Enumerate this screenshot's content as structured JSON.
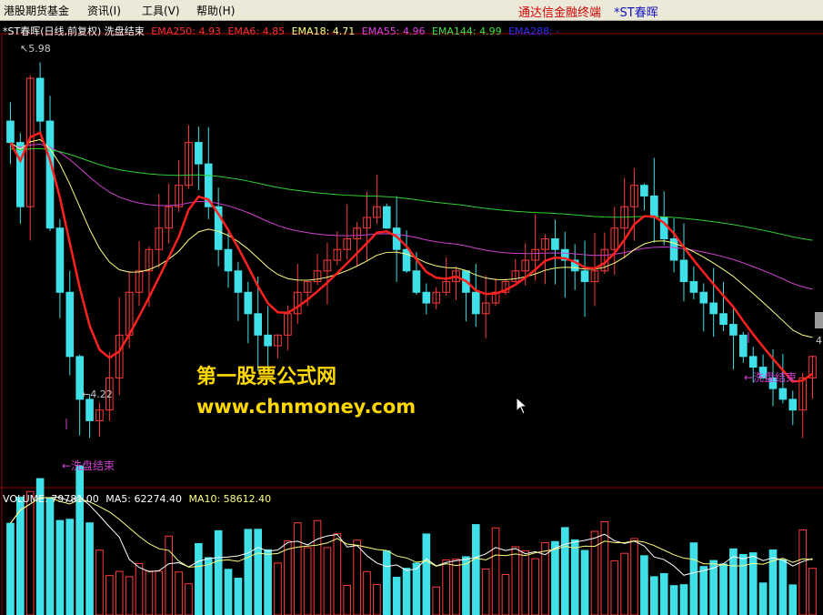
{
  "menu": {
    "items": [
      "港股期货基金",
      "资讯(I)",
      "工具(V)",
      "帮助(H)"
    ],
    "app_title": "通达信金融终端",
    "stock_title": "*ST春晖"
  },
  "main_chart": {
    "header": "*ST春晖(日线,前复权) 洗盘结束",
    "indicators": [
      {
        "label": "EMA250: 4.93",
        "color": "#ff3030"
      },
      {
        "label": "EMA6: 4.85",
        "color": "#ff3030"
      },
      {
        "label": "EMA18: 4.71",
        "color": "#ffff80"
      },
      {
        "label": "EMA55: 4.96",
        "color": "#e040e0"
      },
      {
        "label": "EMA144: 4.99",
        "color": "#40e040"
      },
      {
        "label": "EMA288: -",
        "color": "#3030ff"
      }
    ],
    "high_label": "5.98",
    "low_label": "4.22",
    "signal_label": "洗盘结束",
    "signal_label_right": "←洗盘结束",
    "signal_label_left": "←洗盘结束",
    "right_edge_label": "4"
  },
  "volume_chart": {
    "indicators": [
      {
        "label": "VOLUME: 79781.00",
        "color": "#ffffff"
      },
      {
        "label": "MA5: 62274.40",
        "color": "#ffffff"
      },
      {
        "label": "MA10: 58612.40",
        "color": "#ffff80"
      }
    ]
  },
  "watermark": {
    "line1": "第一股票公式网",
    "line2": "www.chnmoney.com"
  },
  "colors": {
    "up": "#ff3a3a",
    "down": "#40e0e8",
    "grid": "#8b0000",
    "ema6": "#ff2020",
    "ema18": "#ffff80",
    "ema55": "#d040d0",
    "ema144": "#30d030",
    "ema250": "#ff3030"
  },
  "chart_data": {
    "type": "candlestick",
    "note_axis": "price",
    "high": 5.98,
    "low": 4.22,
    "price_range": [
      4.0,
      6.1
    ],
    "closes": [
      5.6,
      5.3,
      5.9,
      5.7,
      5.2,
      4.9,
      4.6,
      4.4,
      4.3,
      4.35,
      4.5,
      4.7,
      4.9,
      5.0,
      5.1,
      5.2,
      5.3,
      5.4,
      5.6,
      5.5,
      5.3,
      5.1,
      5.0,
      4.9,
      4.8,
      4.7,
      4.65,
      4.7,
      4.8,
      4.9,
      4.95,
      5.0,
      5.05,
      5.1,
      5.15,
      5.2,
      5.25,
      5.3,
      5.2,
      5.1,
      5.0,
      4.9,
      4.85,
      4.9,
      4.95,
      5.0,
      4.9,
      4.8,
      4.85,
      4.9,
      4.95,
      5.0,
      5.05,
      5.1,
      5.15,
      5.1,
      5.05,
      5.0,
      4.95,
      5.0,
      5.1,
      5.2,
      5.3,
      5.4,
      5.35,
      5.25,
      5.15,
      5.05,
      4.95,
      4.9,
      4.85,
      4.8,
      4.75,
      4.7,
      4.6,
      4.55,
      4.5,
      4.45,
      4.4,
      4.35,
      4.5,
      4.6
    ]
  }
}
